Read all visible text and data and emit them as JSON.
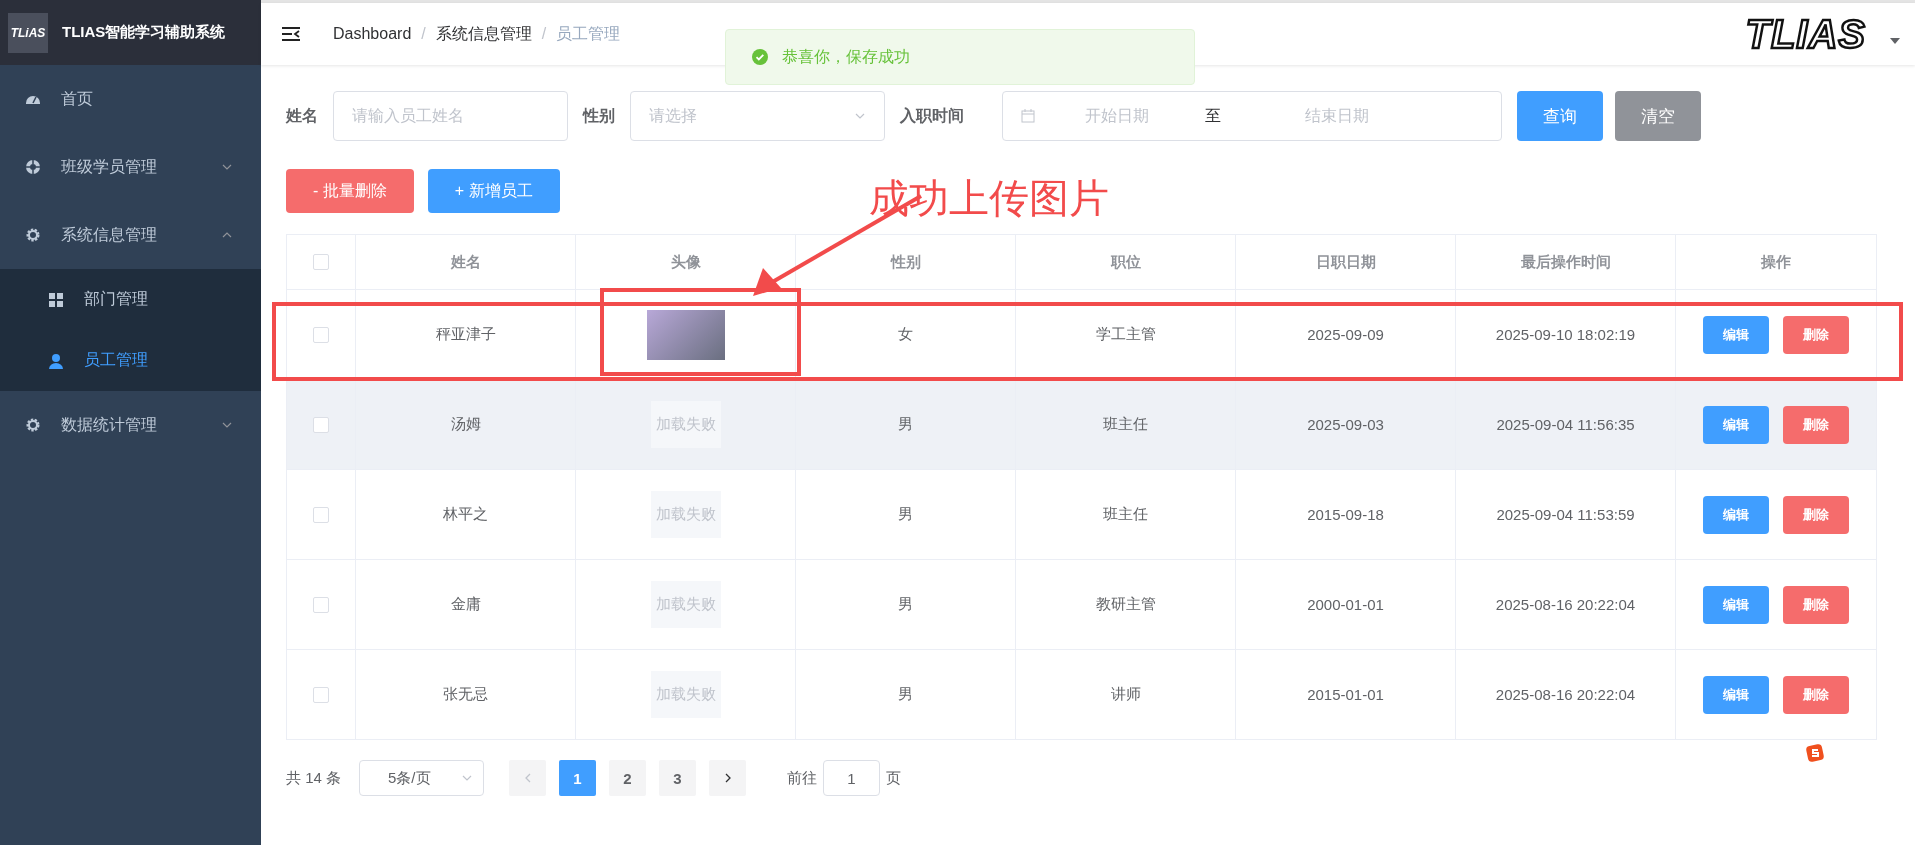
{
  "sidebar": {
    "logo_badge": "TLiAS",
    "title": "TLIAS智能学习辅助系统",
    "items": [
      {
        "label": "首页",
        "kind": "link"
      },
      {
        "label": "班级学员管理",
        "kind": "group",
        "expanded": false
      },
      {
        "label": "系统信息管理",
        "kind": "group",
        "expanded": true,
        "children": [
          {
            "label": "部门管理",
            "selected": false
          },
          {
            "label": "员工管理",
            "selected": true
          }
        ]
      },
      {
        "label": "数据统计管理",
        "kind": "group",
        "expanded": false
      }
    ]
  },
  "header": {
    "breadcrumb": [
      "Dashboard",
      "系统信息管理",
      "员工管理"
    ],
    "breadcrumb_separators": [
      "/",
      "/"
    ],
    "logo_text": "TLIAS"
  },
  "toast": {
    "message": "恭喜你，保存成功"
  },
  "filters": {
    "name_label": "姓名",
    "name_placeholder": "请输入员工姓名",
    "gender_label": "性别",
    "gender_placeholder": "请选择",
    "date_label": "入职时间",
    "start_placeholder": "开始日期",
    "range_separator": "至",
    "end_placeholder": "结束日期",
    "search_button": "查询",
    "clear_button": "清空"
  },
  "actions": {
    "batch_delete": "- 批量删除",
    "add": "+ 新增员工"
  },
  "table": {
    "select_all_checked": false,
    "columns": [
      "姓名",
      "头像",
      "性别",
      "职位",
      "日职日期",
      "最后操作时间",
      "操作"
    ],
    "rows": [
      {
        "checked": false,
        "hovered": false,
        "name": "秤亚津子",
        "avatar": {
          "kind": "image"
        },
        "gender": "女",
        "position": "学工主管",
        "date": "2025-09-09",
        "updated": "2025-09-10 18:02:19",
        "edit": "编辑",
        "delete": "删除"
      },
      {
        "checked": false,
        "hovered": true,
        "name": "汤姆",
        "avatar": {
          "kind": "failed",
          "text": "加载失败"
        },
        "gender": "男",
        "position": "班主任",
        "date": "2025-09-03",
        "updated": "2025-09-04 11:56:35",
        "edit": "编辑",
        "delete": "删除"
      },
      {
        "checked": false,
        "hovered": false,
        "name": "林平之",
        "avatar": {
          "kind": "failed",
          "text": "加载失败"
        },
        "gender": "男",
        "position": "班主任",
        "date": "2015-09-18",
        "updated": "2025-09-04 11:53:59",
        "edit": "编辑",
        "delete": "删除"
      },
      {
        "checked": false,
        "hovered": false,
        "name": "金庸",
        "avatar": {
          "kind": "failed",
          "text": "加载失败"
        },
        "gender": "男",
        "position": "教研主管",
        "date": "2000-01-01",
        "updated": "2025-08-16 20:22:04",
        "edit": "编辑",
        "delete": "删除"
      },
      {
        "checked": false,
        "hovered": false,
        "name": "张无忌",
        "avatar": {
          "kind": "failed",
          "text": "加载失败"
        },
        "gender": "男",
        "position": "讲师",
        "date": "2015-01-01",
        "updated": "2025-08-16 20:22:04",
        "edit": "编辑",
        "delete": "删除"
      }
    ]
  },
  "pagination": {
    "total": "共 14 条",
    "page_size": "5条/页",
    "pages": [
      {
        "label": "1",
        "selected": true
      },
      {
        "label": "2",
        "selected": false
      },
      {
        "label": "3",
        "selected": false
      }
    ],
    "goto_label": "前往",
    "goto_value": "1",
    "goto_unit": "页"
  },
  "annotation": {
    "text": "成功上传图片"
  }
}
